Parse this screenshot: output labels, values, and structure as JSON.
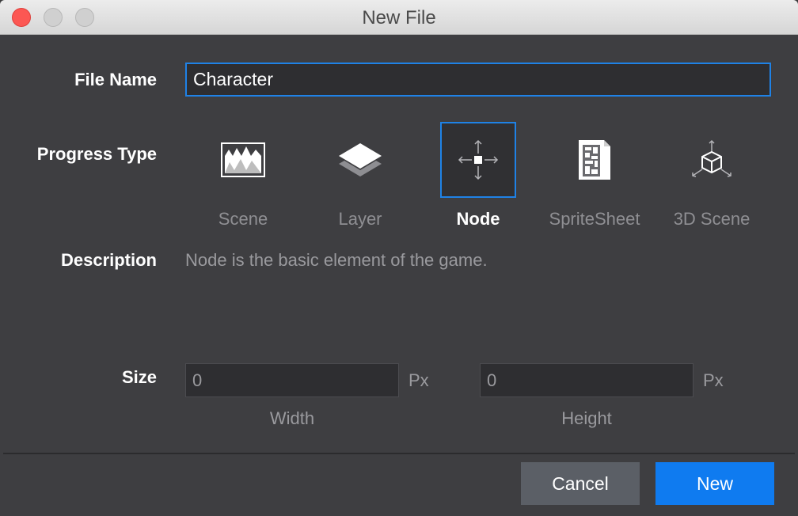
{
  "window": {
    "title": "New File"
  },
  "form": {
    "file_name_label": "File Name",
    "file_name_value": "Character",
    "progress_type_label": "Progress Type",
    "types": [
      {
        "label": "Scene",
        "icon": "scene-icon"
      },
      {
        "label": "Layer",
        "icon": "layer-icon"
      },
      {
        "label": "Node",
        "icon": "node-icon",
        "selected": true
      },
      {
        "label": "SpriteSheet",
        "icon": "spritesheet-icon"
      },
      {
        "label": "3D Scene",
        "icon": "3d-scene-icon"
      }
    ],
    "description_label": "Description",
    "description_text": "Node is the basic element of the game.",
    "size_label": "Size",
    "width_value": "0",
    "height_value": "0",
    "unit": "Px",
    "width_label": "Width",
    "height_label": "Height"
  },
  "buttons": {
    "cancel": "Cancel",
    "create": "New"
  },
  "colors": {
    "accent": "#1f82e6",
    "primary_button": "#0f7bf0",
    "background": "#3e3e41"
  }
}
